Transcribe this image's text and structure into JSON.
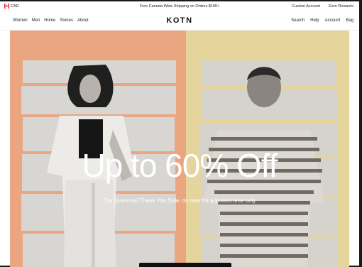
{
  "announcement": {
    "currency": "CAD",
    "promo": "Free Canada-Wide Shipping on Orders $100+",
    "links": [
      "Custom Account",
      "Earn Rewards"
    ]
  },
  "nav": {
    "logo": "KOTN",
    "left_items": [
      "Women",
      "Men",
      "Home",
      "Stories",
      "About"
    ],
    "right_items": [
      "Search",
      "Help",
      "Account",
      "Bag"
    ]
  },
  "hero": {
    "headline": "Up to 60% Off",
    "subline": "Our bi-annual Thank You Sale, on now for a limited time only"
  },
  "colors": {
    "left_panel": "#e9a681",
    "right_panel": "#e5d49b",
    "flag_red": "#d9262b"
  }
}
